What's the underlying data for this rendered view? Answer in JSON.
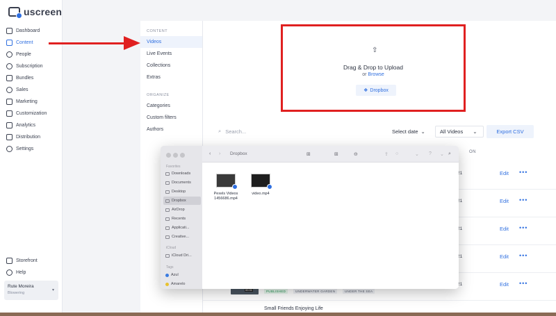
{
  "brand": {
    "name": "uscreen"
  },
  "sidebar": {
    "items": [
      {
        "label": "Dashboard",
        "icon": "grid-icon"
      },
      {
        "label": "Content",
        "icon": "content-icon",
        "active": true
      },
      {
        "label": "People",
        "icon": "people-icon"
      },
      {
        "label": "Subscription",
        "icon": "subscription-icon"
      },
      {
        "label": "Bundles",
        "icon": "bundles-icon"
      },
      {
        "label": "Sales",
        "icon": "sales-icon"
      },
      {
        "label": "Marketing",
        "icon": "marketing-icon"
      },
      {
        "label": "Customization",
        "icon": "customization-icon"
      },
      {
        "label": "Analytics",
        "icon": "analytics-icon"
      },
      {
        "label": "Distribution",
        "icon": "distribution-icon"
      },
      {
        "label": "Settings",
        "icon": "settings-icon"
      }
    ],
    "bottom": [
      {
        "label": "Storefront",
        "icon": "storefront-icon"
      },
      {
        "label": "Help",
        "icon": "help-icon"
      }
    ],
    "user": {
      "name": "Rute Moreira",
      "subtitle": "Blowering"
    }
  },
  "submenu": {
    "content_heading": "CONTENT",
    "content_items": [
      "Videos",
      "Live Events",
      "Collections",
      "Extras"
    ],
    "organize_heading": "ORGANIZE",
    "organize_items": [
      "Categories",
      "Custom filters",
      "Authors"
    ]
  },
  "upload": {
    "title": "Drag & Drop to Upload",
    "or_text": "or",
    "browse": "Browse",
    "dropbox_button": "Dropbox"
  },
  "toolbar": {
    "search_placeholder": "Search...",
    "select_date": "Select date",
    "all_videos": "All Videos",
    "export": "Export CSV",
    "col_on": "ON"
  },
  "rows": [
    {
      "date": "21",
      "edit": "Edit",
      "more": "•••"
    },
    {
      "date": "21",
      "edit": "Edit",
      "more": "•••"
    },
    {
      "date": "21",
      "edit": "Edit",
      "more": "•••"
    },
    {
      "date": "21",
      "edit": "Edit",
      "more": "•••"
    },
    {
      "date": "21",
      "edit": "Edit",
      "more": "•••"
    }
  ],
  "last_row": {
    "duration": "00:31",
    "tags": [
      "PUBLISHED",
      "UNDERWATER GARDEN",
      "UNDER THE SEA"
    ],
    "next_title": "Small Friends Enjoying Life"
  },
  "finder": {
    "title": "Dropbox",
    "favorites_heading": "Favorites",
    "favorites": [
      "Downloads",
      "Documents",
      "Desktop",
      "Dropbox",
      "AirDrop",
      "Recents",
      "Applicati...",
      "Creative..."
    ],
    "icloud_heading": "iCloud",
    "icloud": [
      "iCloud Dri..."
    ],
    "tags_heading": "Tags",
    "tags": [
      "Azul",
      "Amarelo"
    ],
    "files": [
      {
        "name": "Pexels Videos 1456686.mp4"
      },
      {
        "name": "video.mp4"
      }
    ]
  },
  "colors": {
    "accent": "#2f6fe0",
    "highlight_red": "#e02020"
  }
}
